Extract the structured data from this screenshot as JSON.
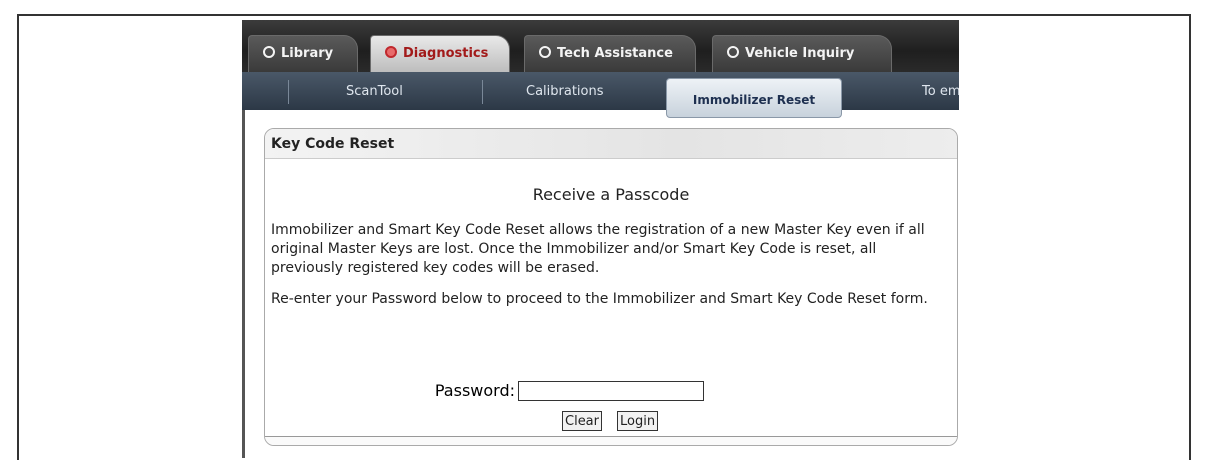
{
  "tabs": [
    {
      "label": "Library"
    },
    {
      "label": "Diagnostics"
    },
    {
      "label": "Tech Assistance"
    },
    {
      "label": "Vehicle Inquiry"
    }
  ],
  "subtabs": [
    {
      "label": "ScanTool"
    },
    {
      "label": "Calibrations"
    },
    {
      "label": "Immobilizer Reset"
    },
    {
      "label": "To em"
    }
  ],
  "panel": {
    "header": "Key Code Reset",
    "title": "Receive a Passcode",
    "paragraph1": "Immobilizer and Smart Key Code Reset allows the registration of a new Master Key even if all original Master Keys are lost. Once the Immobilizer and/or Smart Key Code is reset, all previously registered key codes will be erased.",
    "paragraph2": "Re-enter your Password below to proceed to the Immobilizer and Smart Key Code Reset form.",
    "password_label": "Password:",
    "password_value": "",
    "clear_label": "Clear",
    "login_label": "Login"
  },
  "colors": {
    "active_tab_text": "#a21a1a",
    "subbar": "#2c3846"
  }
}
